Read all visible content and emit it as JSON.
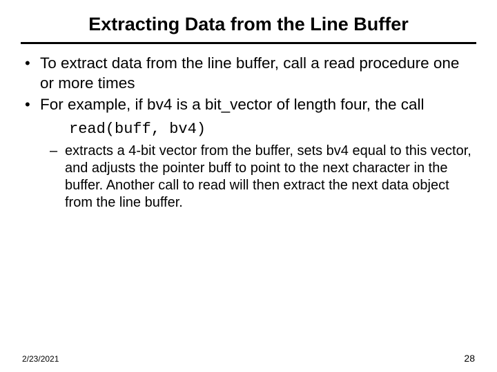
{
  "title": "Extracting Data from the Line Buffer",
  "bullets": {
    "b1": "To extract data from the line buffer, call a read procedure one or more times",
    "b2": "For example, if bv4 is a bit_vector of length four, the call",
    "code": "read(buff, bv4)",
    "sub1": "extracts a 4-bit vector from the buffer, sets bv4 equal to this vector, and adjusts the pointer buff to point to the next character in the buffer. Another call to read will then extract the next data object from the line buffer."
  },
  "footer": {
    "date": "2/23/2021",
    "page": "28"
  }
}
